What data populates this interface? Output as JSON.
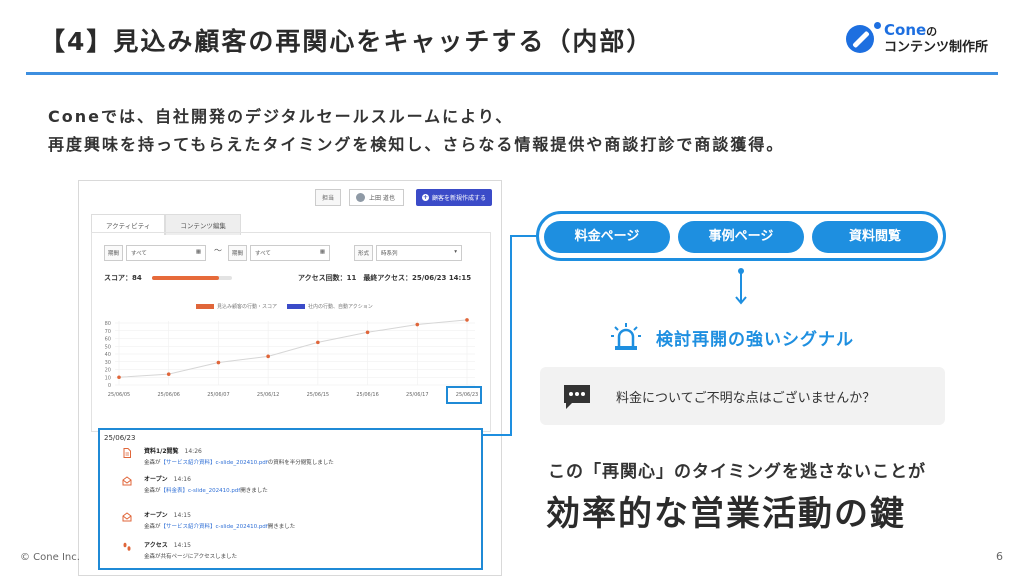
{
  "header": {
    "title": "【4】見込み顧客の再関心をキャッチする（内部）",
    "logo_brand": "Cone",
    "logo_no": "の",
    "logo_line2": "コンテンツ制作所"
  },
  "lead": {
    "line1": "Coneでは、自社開発のデジタルセールスルームにより、",
    "line2": "再度興味を持ってもらえたタイミングを検知し、さらなる情報提供や商談打診で商談獲得。"
  },
  "app": {
    "tag_label": "担当",
    "user_name": "上田 道也",
    "new_button": "顧客を新規作成する",
    "tabs": [
      "アクティビティ",
      "コンテンツ編集"
    ],
    "filter_period_label": "期間",
    "filter_period_value1": "すべて",
    "filter_period_value2": "すべて",
    "filter_format_label": "形式",
    "filter_format_value": "時系列",
    "tilde": "〜",
    "score_label": "スコア：84",
    "score_value": 0.84,
    "access_label": "アクセス回数：11　最終アクセス：25/06/23 14:15",
    "legend": [
      "見込み顧客の行動・スコア",
      "社内の行動、自動アクション"
    ],
    "feed_date": "25/06/23",
    "feed": [
      {
        "icon": "document-icon",
        "title": "資料1/2閲覧",
        "time": "14:26",
        "pre": "金森が",
        "link": "【サービス紹介資料】c-slide_202410.pdf",
        "post": "の資料を半分閲覧しました"
      },
      {
        "icon": "envelope-icon",
        "title": "オープン",
        "time": "14:16",
        "pre": "金森が",
        "link": "【料金表】c-slide_202410.pdf",
        "post": "開きました"
      },
      {
        "icon": "envelope-icon",
        "title": "オープン",
        "time": "14:15",
        "pre": "金森が",
        "link": "【サービス紹介資料】c-slide_202410.pdf",
        "post": "開きました"
      },
      {
        "icon": "footprint-icon",
        "title": "アクセス",
        "time": "14:15",
        "pre": "金森が共有ページにアクセスしました",
        "link": "",
        "post": ""
      }
    ]
  },
  "chart_data": {
    "type": "line",
    "categories": [
      "25/06/05",
      "25/06/06",
      "25/06/07",
      "25/06/12",
      "25/06/15",
      "25/06/16",
      "25/06/17",
      "25/06/23"
    ],
    "series": [
      {
        "name": "見込み顧客の行動・スコア",
        "values": [
          10,
          14,
          29,
          37,
          55,
          68,
          78,
          84
        ]
      }
    ],
    "yticks": [
      0,
      10,
      20,
      30,
      40,
      50,
      60,
      70,
      80
    ],
    "ylim": [
      0,
      80
    ],
    "colors": {
      "line": "#d6d6d6",
      "point": "#e0663a",
      "legend1": "#e0663a",
      "legend2": "#3b4bc8"
    }
  },
  "pills": [
    "料金ページ",
    "事例ページ",
    "資料閲覧"
  ],
  "signal": "検討再開の強いシグナル",
  "chat": "料金についてご不明な点はございませんか？",
  "subtitle": "この「再関心」のタイミングを逃さないことが",
  "headline": "効率的な営業活動の鍵",
  "footer": {
    "copyright": "© Cone Inc.",
    "page": "6"
  },
  "colors": {
    "accent": "#1e8fe0",
    "rule": "#3d8fe0"
  }
}
